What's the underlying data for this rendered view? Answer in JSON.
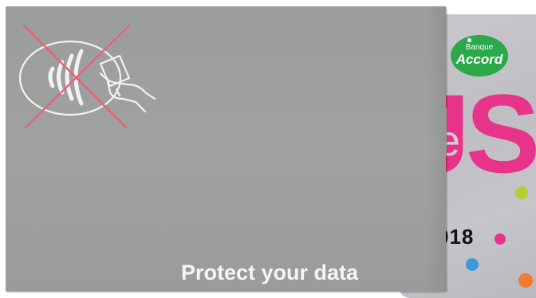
{
  "sleeve": {
    "caption": "Protect your data",
    "color": "#9fa2a0",
    "symbol": {
      "icon": "contactless-hand-icon",
      "status": "crossed-out",
      "cross_color": "#e8607a"
    }
  },
  "card": {
    "bank_logo_small": "Banque",
    "bank_logo_large": "Accord",
    "logo_color": "#2aa84a",
    "brand_fragment": "JS",
    "ghost_text": "rte",
    "number_fragment": "018",
    "accent_colors": [
      "#b5cf2d",
      "#e8338b",
      "#3f97dc",
      "#ef7d2b"
    ]
  }
}
